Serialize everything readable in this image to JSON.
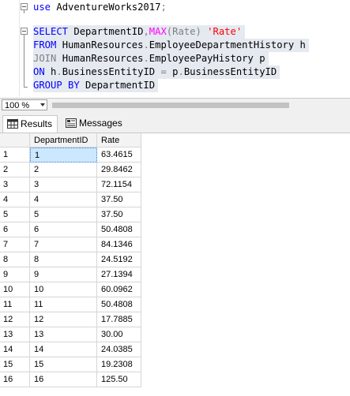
{
  "editor": {
    "line1": {
      "kw": "use",
      "db": "AdventureWorks2017",
      "end": ";"
    },
    "line3": {
      "kw": "SELECT",
      "col": "DepartmentID",
      "comma": ",",
      "fn": "MAX",
      "arg": "(Rate)",
      "alias": "'Rate'"
    },
    "line4": {
      "kw": "FROM",
      "table": "HumanResources",
      "dot": ".",
      "name": "EmployeeDepartmentHistory h"
    },
    "line5": {
      "kw": "JOIN",
      "table": "HumanResources",
      "dot": ".",
      "name": "EmployeePayHistory p"
    },
    "line6": {
      "kw": "ON",
      "left": "h",
      "dot1": ".",
      "lcol": "BusinessEntityID",
      "eq": " = ",
      "right": "p",
      "dot2": ".",
      "rcol": "BusinessEntityID"
    },
    "line7": {
      "kw": "GROUP BY",
      "col": "DepartmentID"
    }
  },
  "zoom": {
    "value": "100 %"
  },
  "tabs": [
    {
      "label": "Results",
      "icon": "grid-icon",
      "active": true
    },
    {
      "label": "Messages",
      "icon": "messages-icon",
      "active": false
    }
  ],
  "grid": {
    "columns": [
      "DepartmentID",
      "Rate"
    ],
    "rows": [
      {
        "n": "1",
        "dept": "1",
        "rate": "63.4615"
      },
      {
        "n": "2",
        "dept": "2",
        "rate": "29.8462"
      },
      {
        "n": "3",
        "dept": "3",
        "rate": "72.1154"
      },
      {
        "n": "4",
        "dept": "4",
        "rate": "37.50"
      },
      {
        "n": "5",
        "dept": "5",
        "rate": "37.50"
      },
      {
        "n": "6",
        "dept": "6",
        "rate": "50.4808"
      },
      {
        "n": "7",
        "dept": "7",
        "rate": "84.1346"
      },
      {
        "n": "8",
        "dept": "8",
        "rate": "24.5192"
      },
      {
        "n": "9",
        "dept": "9",
        "rate": "27.1394"
      },
      {
        "n": "10",
        "dept": "10",
        "rate": "60.0962"
      },
      {
        "n": "11",
        "dept": "11",
        "rate": "50.4808"
      },
      {
        "n": "12",
        "dept": "12",
        "rate": "17.7885"
      },
      {
        "n": "13",
        "dept": "13",
        "rate": "30.00"
      },
      {
        "n": "14",
        "dept": "14",
        "rate": "24.0385"
      },
      {
        "n": "15",
        "dept": "15",
        "rate": "19.2308"
      },
      {
        "n": "16",
        "dept": "16",
        "rate": "125.50"
      }
    ]
  },
  "colors": {
    "keyword": "#0000ff",
    "function": "#ff00ff",
    "string": "#ff0000",
    "selection": "#e5e9f0",
    "selected_cell": "#cce8ff"
  }
}
